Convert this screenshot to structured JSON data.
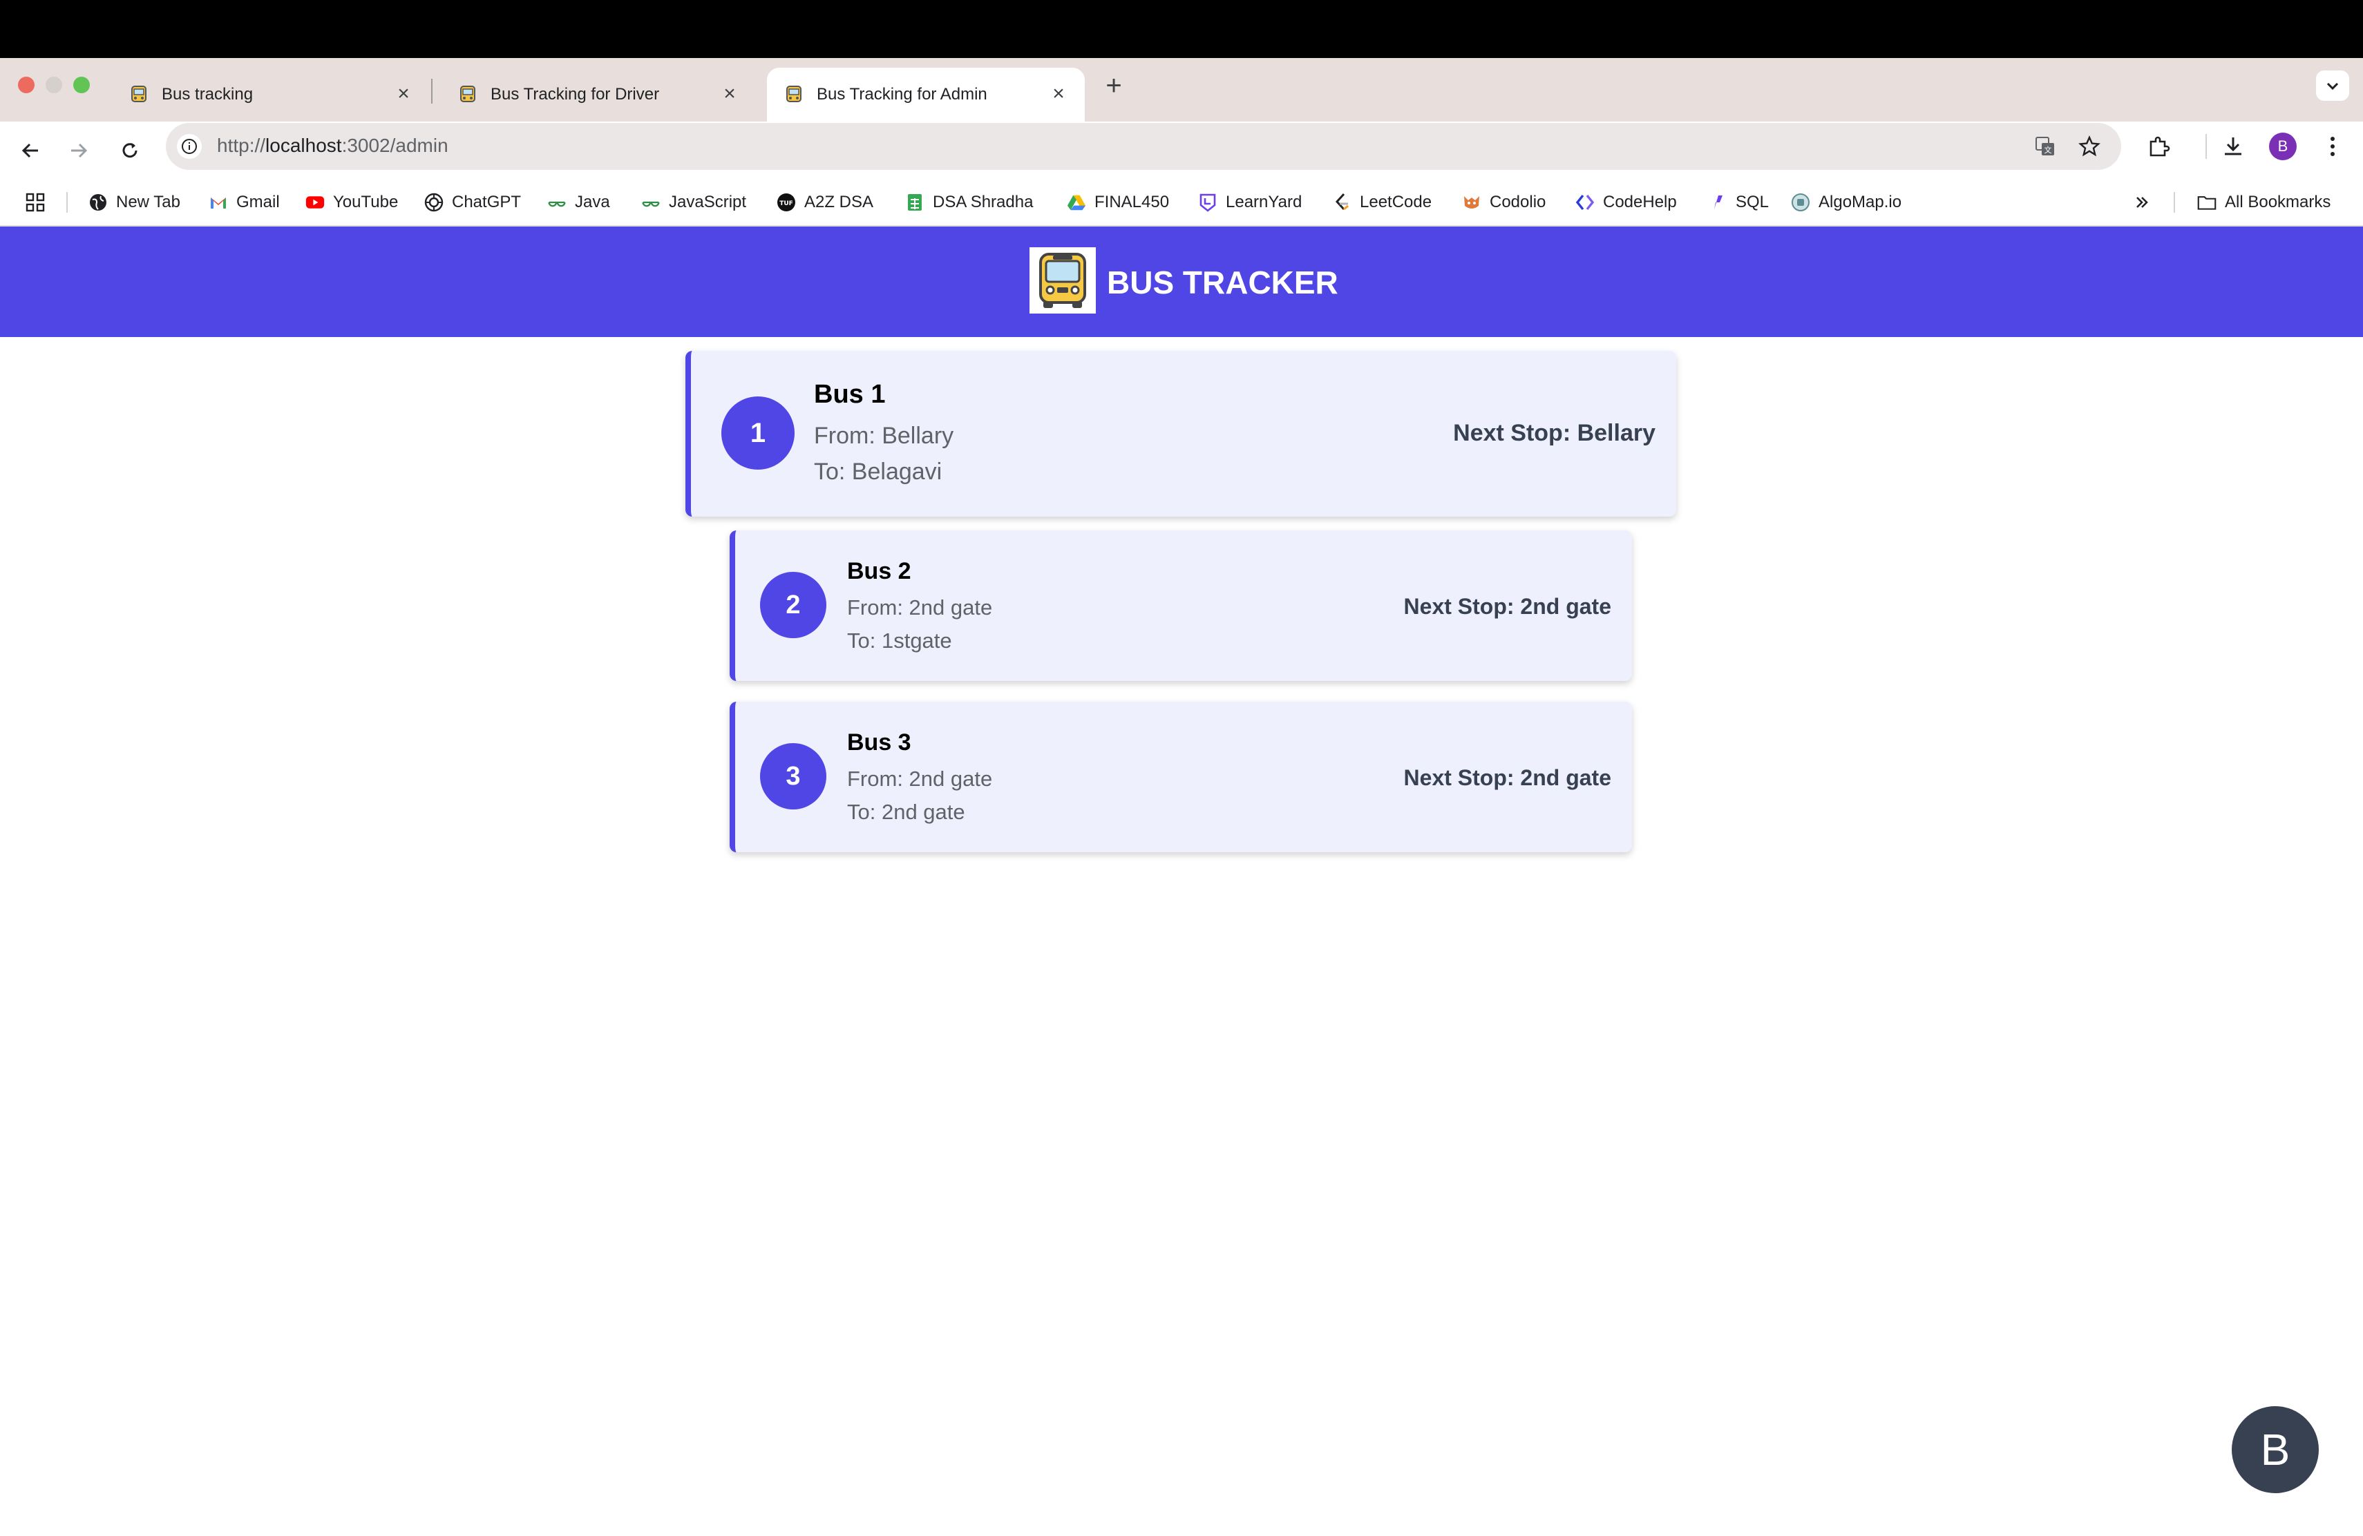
{
  "browser": {
    "tabs": [
      {
        "title": "Bus tracking",
        "active": false
      },
      {
        "title": "Bus Tracking for Driver",
        "active": false
      },
      {
        "title": "Bus Tracking for Admin",
        "active": true
      }
    ],
    "url_scheme": "http://",
    "url_host": "localhost",
    "url_rest": ":3002/admin",
    "profile_initial": "B",
    "bookmarks": [
      {
        "label": "New Tab",
        "icon": "globe-icon"
      },
      {
        "label": "Gmail",
        "icon": "gmail-icon"
      },
      {
        "label": "YouTube",
        "icon": "youtube-icon"
      },
      {
        "label": "ChatGPT",
        "icon": "chatgpt-icon"
      },
      {
        "label": "Java",
        "icon": "gfg-icon"
      },
      {
        "label": "JavaScript",
        "icon": "gfg-icon"
      },
      {
        "label": "A2Z DSA",
        "icon": "tuf-icon"
      },
      {
        "label": "DSA Shradha",
        "icon": "sheets-icon"
      },
      {
        "label": "FINAL450",
        "icon": "drive-icon"
      },
      {
        "label": "LearnYard",
        "icon": "learnyard-icon"
      },
      {
        "label": "LeetCode",
        "icon": "leetcode-icon"
      },
      {
        "label": "Codolio",
        "icon": "codolio-icon"
      },
      {
        "label": "CodeHelp",
        "icon": "codehelp-icon"
      },
      {
        "label": "SQL",
        "icon": "sql-icon"
      },
      {
        "label": "AlgoMap.io",
        "icon": "algomap-icon"
      }
    ],
    "all_bookmarks_label": "All Bookmarks",
    "colors": {
      "tabstrip": "#e8dfdc",
      "omnibox": "#ebe7e6"
    }
  },
  "app": {
    "title": "BUS TRACKER",
    "accent_color": "#4f46e5",
    "card_bg": "#eef0fd",
    "buses": [
      {
        "number": "1",
        "name": "Bus 1",
        "from": "From: Bellary",
        "to": "To: Belagavi",
        "next_stop": "Next Stop: Bellary"
      },
      {
        "number": "2",
        "name": "Bus 2",
        "from": "From: 2nd gate",
        "to": "To: 1stgate",
        "next_stop": "Next Stop: 2nd gate"
      },
      {
        "number": "3",
        "name": "Bus 3",
        "from": "From: 2nd gate",
        "to": "To: 2nd gate",
        "next_stop": "Next Stop: 2nd gate"
      }
    ],
    "user_avatar_initial": "B"
  }
}
